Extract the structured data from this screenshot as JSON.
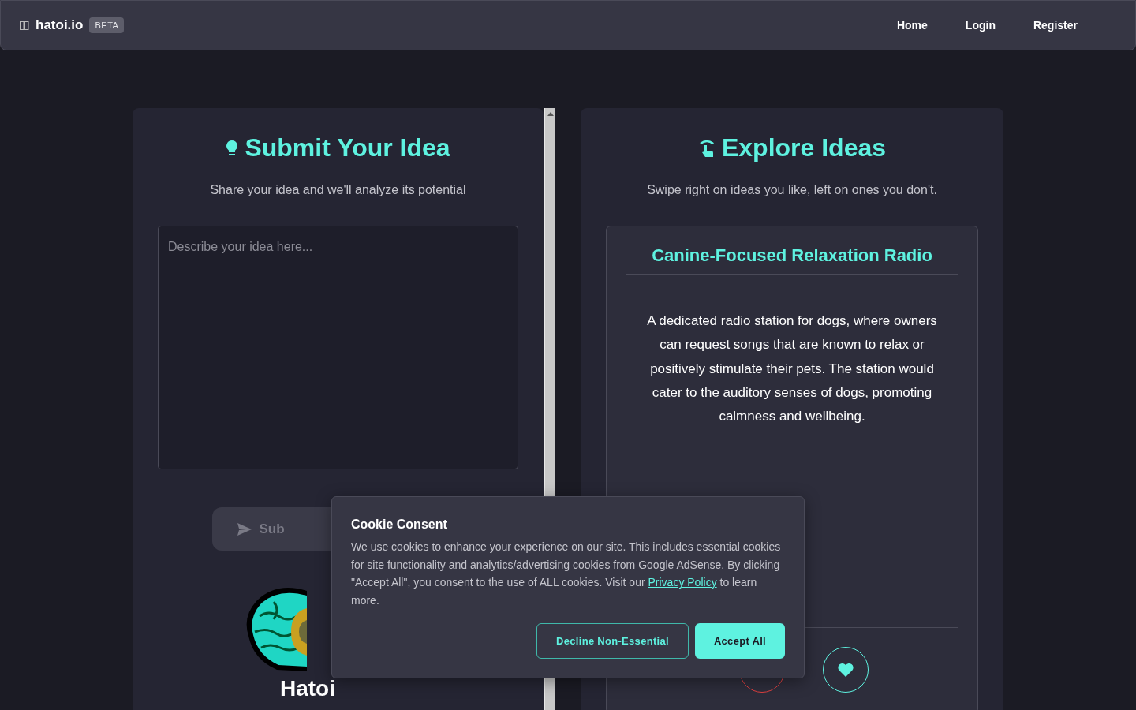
{
  "navbar": {
    "brand": "hatoi.io",
    "badge": "BETA",
    "links": [
      {
        "label": "Home"
      },
      {
        "label": "Login"
      },
      {
        "label": "Register"
      }
    ]
  },
  "submit_panel": {
    "title": "Submit Your Idea",
    "subtitle": "Share your idea and we'll analyze its potential",
    "placeholder": "Describe your idea here...",
    "button": "Sub",
    "logo_text": "Hatoi"
  },
  "explore_panel": {
    "title": "Explore Ideas",
    "subtitle": "Swipe right on ideas you like, left on ones you don't.",
    "idea": {
      "title": "Canine-Focused Relaxation Radio",
      "description": "A dedicated radio station for dogs, where owners can request songs that are known to relax or positively stimulate their pets. The station would cater to the auditory senses of dogs, promoting calmness and wellbeing."
    }
  },
  "cookie_consent": {
    "title": "Cookie Consent",
    "text": "We use cookies to enhance your experience on our site. This includes essential cookies for site functionality and analytics/advertising cookies from Google AdSense. By clicking \"Accept All\", you consent to the use of ALL cookies. Visit our",
    "link": "Privacy Policy",
    "text_after": "to learn more.",
    "buttons": [
      {
        "label": "Decline Non-Essential",
        "kind": "outline"
      },
      {
        "label": "Accept All",
        "kind": "primary"
      }
    ]
  }
}
